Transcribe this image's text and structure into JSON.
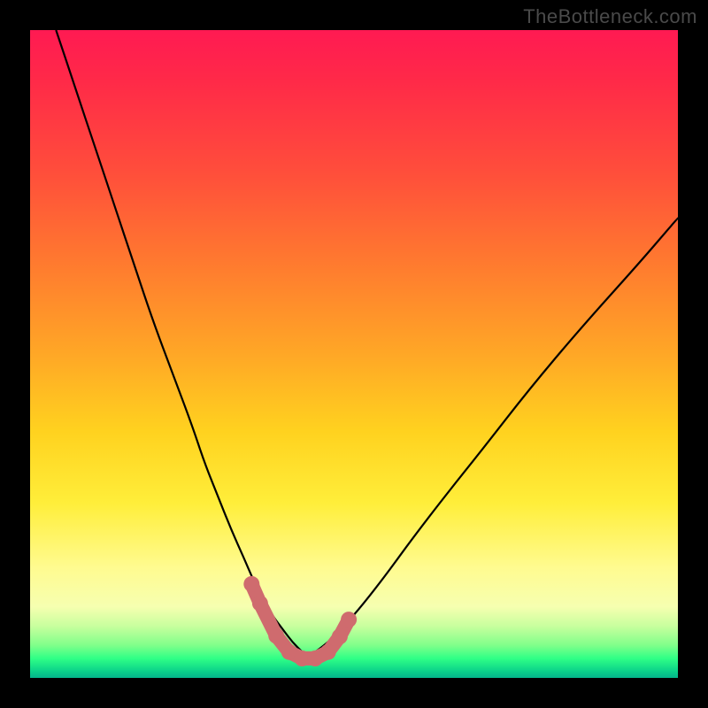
{
  "watermark": "TheBottleneck.com",
  "chart_data": {
    "type": "line",
    "title": "",
    "xlabel": "",
    "ylabel": "",
    "xlim": [
      0,
      100
    ],
    "ylim": [
      0,
      100
    ],
    "grid": false,
    "legend": false,
    "background_gradient": {
      "stops": [
        {
          "pos": 0,
          "color": "#ff1a52"
        },
        {
          "pos": 22,
          "color": "#ff4e3b"
        },
        {
          "pos": 50,
          "color": "#ffa726"
        },
        {
          "pos": 73,
          "color": "#ffee3a"
        },
        {
          "pos": 89,
          "color": "#f6ffb0"
        },
        {
          "pos": 97,
          "color": "#2fff86"
        },
        {
          "pos": 100,
          "color": "#04b58b"
        }
      ]
    },
    "series": [
      {
        "name": "left-branch",
        "stroke": "#000000",
        "x": [
          4,
          7,
          10,
          13,
          16,
          19,
          22,
          25,
          27,
          29,
          31,
          33,
          34.5,
          36,
          37.5,
          39,
          40.5,
          42
        ],
        "y": [
          100,
          91,
          82,
          73,
          64,
          55,
          47,
          39,
          33,
          28,
          23,
          18.5,
          15,
          12,
          9.5,
          7.5,
          5.5,
          4
        ]
      },
      {
        "name": "right-branch",
        "stroke": "#000000",
        "x": [
          44,
          46,
          48.5,
          51.5,
          55,
          59,
          64,
          70,
          77,
          85,
          94,
          100
        ],
        "y": [
          4,
          5.5,
          8,
          11.5,
          16,
          21.5,
          28,
          35.5,
          44.5,
          54,
          64,
          71
        ]
      },
      {
        "name": "bottom-markers",
        "stroke": "#cf6b6e",
        "marker": "circle",
        "marker_fill": "#cf6b6e",
        "marker_radius_px": 9,
        "x": [
          34.2,
          35.5,
          38,
          40,
          42,
          44,
          46,
          47.8,
          49.2
        ],
        "y": [
          14.5,
          11.5,
          6.5,
          4,
          3,
          3,
          4,
          6.4,
          9
        ]
      }
    ],
    "annotations": []
  }
}
